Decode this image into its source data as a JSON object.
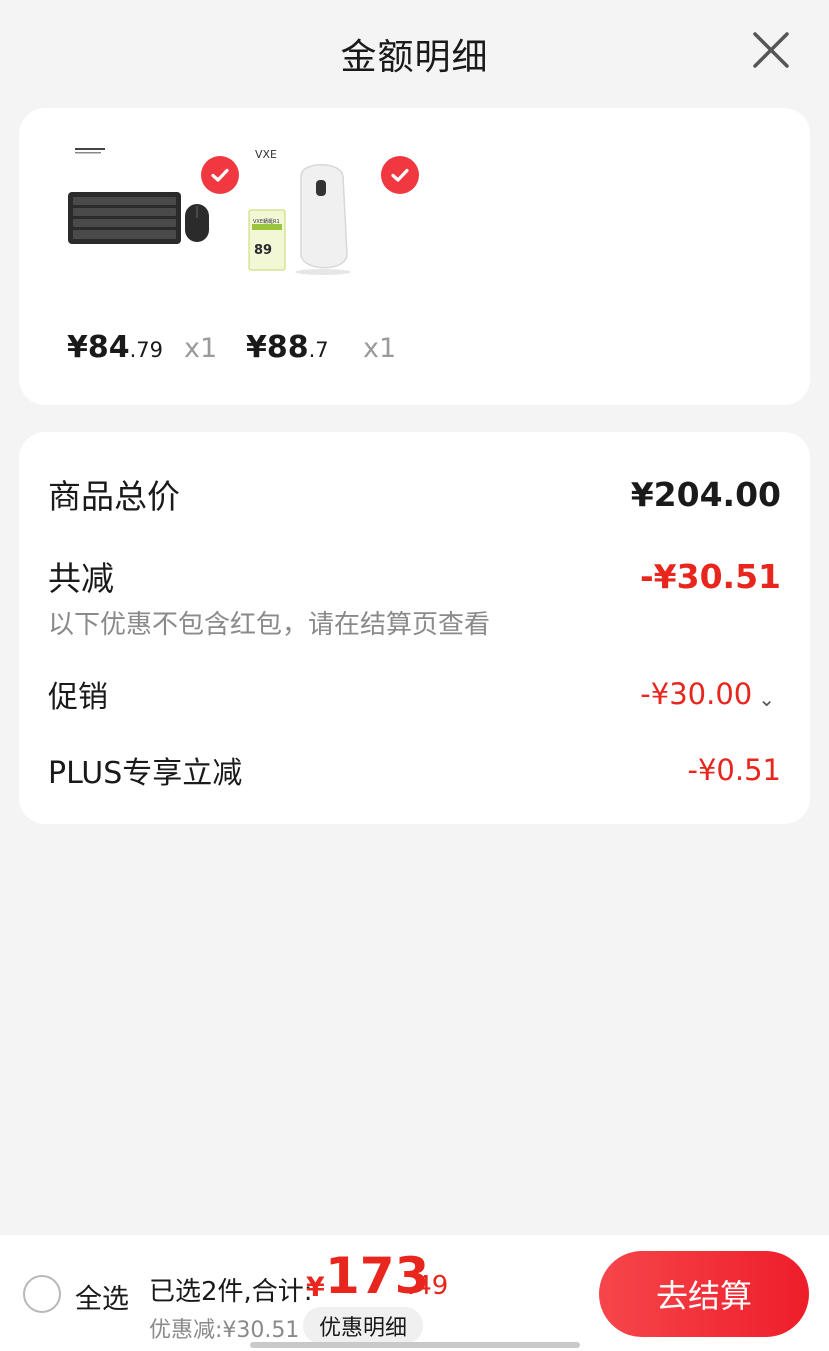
{
  "header": {
    "title": "金额明细",
    "close_icon": "close-icon"
  },
  "products": [
    {
      "name": "keyboard-mouse-set",
      "price_int": "¥84",
      "price_dec": ".79",
      "qty": "x1"
    },
    {
      "name": "vxe-mouse",
      "brand_logo": "VXE",
      "badge_title": "VXE蜻蜓R1",
      "badge_value": "89",
      "price_int": "¥88",
      "price_dec": ".7",
      "qty": "x1"
    }
  ],
  "summary": {
    "total_label": "商品总价",
    "total_value": "¥204.00",
    "reduce_label": "共减",
    "reduce_value": "-¥30.51",
    "note": "以下优惠不包含红包，请在结算页查看",
    "promo_label": "促销",
    "promo_value": "-¥30.00",
    "plus_label": "PLUS专享立减",
    "plus_value": "-¥0.51"
  },
  "bottom": {
    "select_all": "全选",
    "selected_text": "已选2件,合计:",
    "total_symbol": "¥",
    "total_int": "173",
    "total_dec": ".49",
    "discount_text": "优惠减:¥30.51",
    "detail_button": "优惠明细",
    "checkout_button": "去结算"
  },
  "colors": {
    "accent_red": "#e8261d",
    "button_red": "#f1373f",
    "background": "#f4f4f4"
  }
}
